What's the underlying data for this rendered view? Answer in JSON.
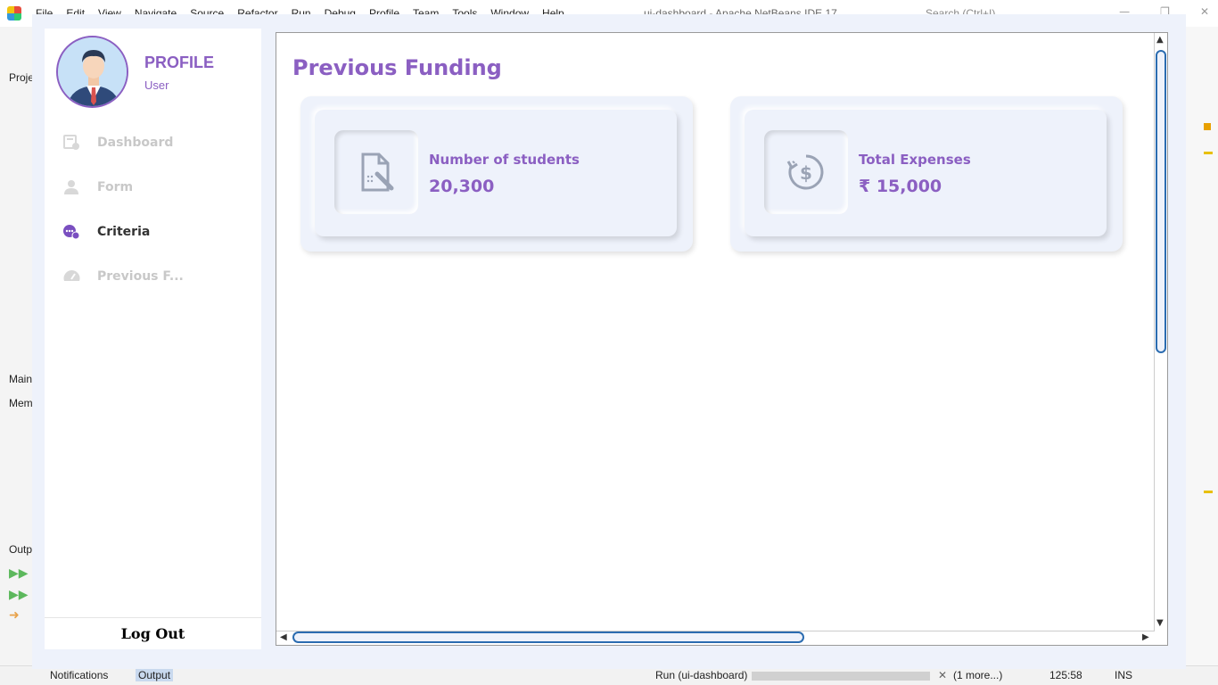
{
  "ide": {
    "menu": [
      "File",
      "Edit",
      "View",
      "Navigate",
      "Source",
      "Refactor",
      "Run",
      "Debug",
      "Profile",
      "Team",
      "Tools",
      "Window",
      "Help"
    ],
    "window_title": "ui-dashboard - Apache NetBeans IDE 17",
    "search_placeholder": "Search (Ctrl+I)",
    "left_labels": {
      "projects": "Proje",
      "main": "Main",
      "member": "Mem",
      "output": "Outp"
    },
    "status": {
      "notifications": "Notifications",
      "output": "Output",
      "run_task": "Run (ui-dashboard)",
      "more": "(1 more...)",
      "position": "125:58",
      "mode": "INS"
    }
  },
  "profile": {
    "title": "PROFILE",
    "role": "User"
  },
  "nav": [
    {
      "label": "Dashboard",
      "icon": "dashboard-icon",
      "active": false
    },
    {
      "label": "Form",
      "icon": "user-icon",
      "active": false
    },
    {
      "label": "Criteria",
      "icon": "chat-icon",
      "active": true
    },
    {
      "label": "Previous F...",
      "icon": "speedometer-icon",
      "active": false
    }
  ],
  "logout_label": "Log Out",
  "main": {
    "title": "Previous Funding",
    "cards": [
      {
        "label": "Number of students",
        "value": "20,300",
        "icon": "document-edit-icon"
      },
      {
        "label": "Total Expenses",
        "value": "₹ 15,000",
        "icon": "money-history-icon"
      }
    ]
  },
  "colors": {
    "accent": "#8b5fc2",
    "background": "#eef2fb",
    "scroll": "#2b6cb0"
  }
}
